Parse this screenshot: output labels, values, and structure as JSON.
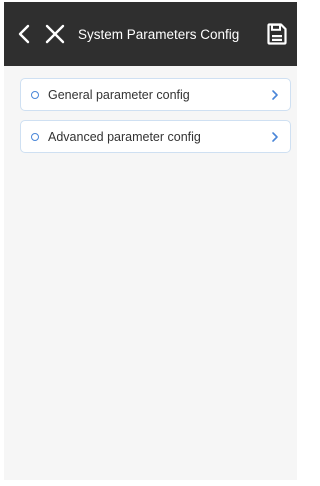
{
  "header": {
    "title": "System Parameters Config",
    "icons": [
      "chevron-left-icon",
      "close-icon",
      "save-icon"
    ]
  },
  "items": [
    {
      "label": "General parameter config"
    },
    {
      "label": "Advanced parameter config"
    }
  ],
  "colors": {
    "header_bg": "#2f2f2f",
    "page_bg": "#f6f6f6",
    "accent": "#4a86d8",
    "item_border": "#cfe0f2"
  }
}
